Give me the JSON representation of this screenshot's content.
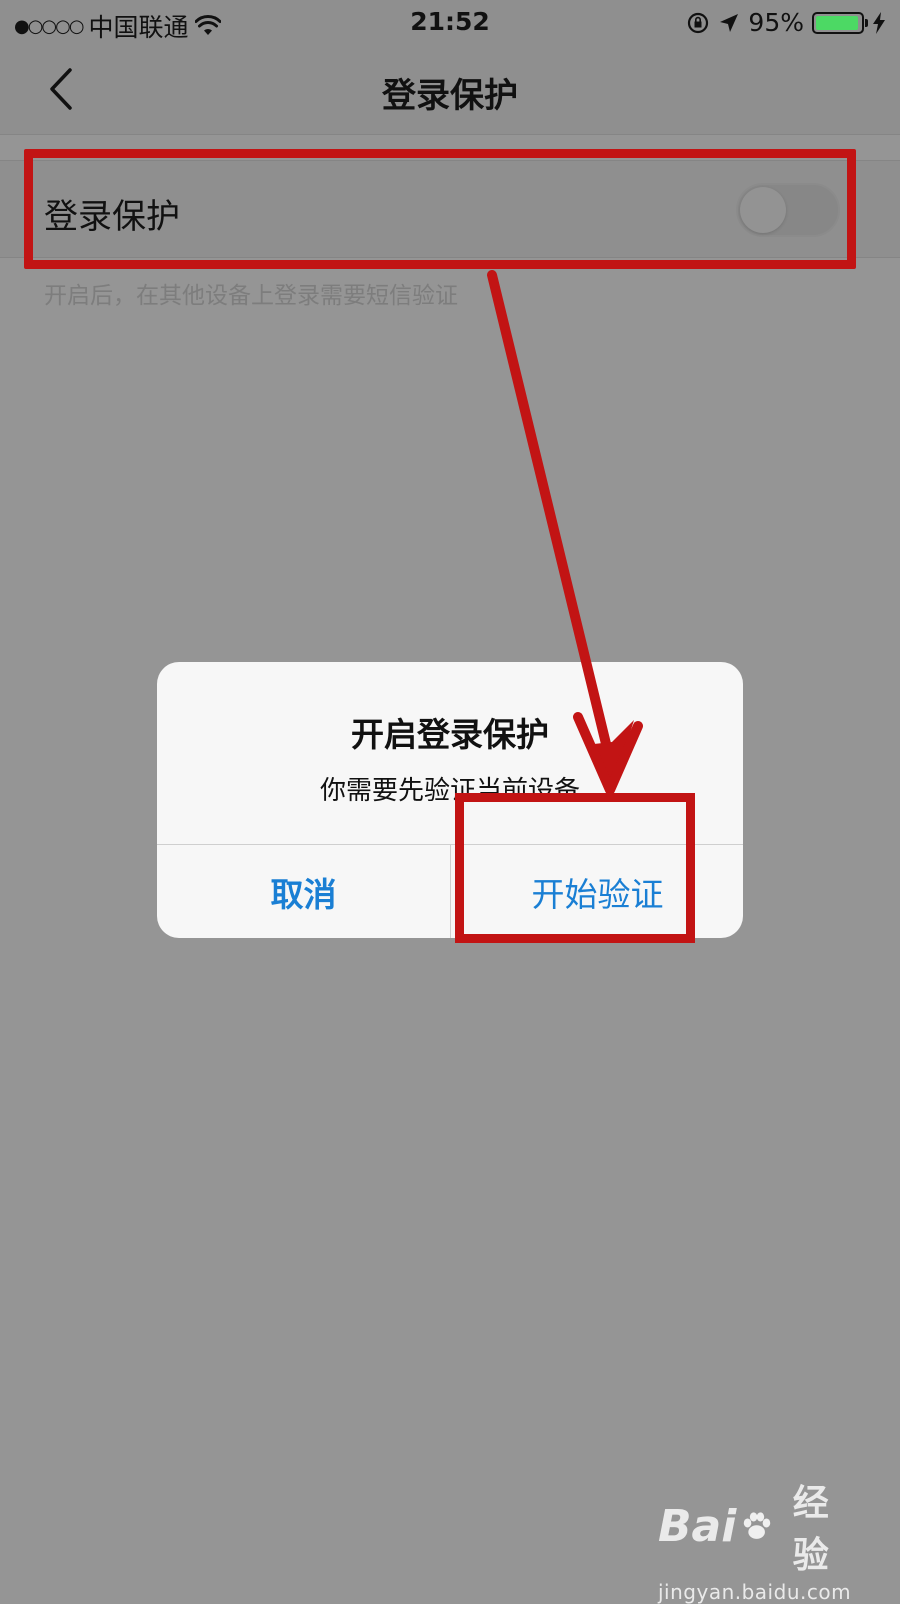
{
  "status_bar": {
    "signal": "●○○○○",
    "carrier": "中国联通",
    "time": "21:52",
    "battery_percent": "95%",
    "battery_level": 0.95,
    "battery_color": "#4cd964"
  },
  "nav": {
    "title": "登录保护",
    "back_icon": "chevron-left-icon"
  },
  "settings": {
    "row_label": "登录保护",
    "toggle_on": false,
    "hint": "开启后，在其他设备上登录需要短信验证"
  },
  "dialog": {
    "title": "开启登录保护",
    "message": "你需要先验证当前设备",
    "cancel_label": "取消",
    "confirm_label": "开始验证",
    "button_color": "#1a7fd4"
  },
  "annotation": {
    "color": "#c21414"
  },
  "watermark": {
    "logo_text_left": "Bai",
    "logo_text_right": "经验",
    "url": "jingyan.baidu.com"
  }
}
